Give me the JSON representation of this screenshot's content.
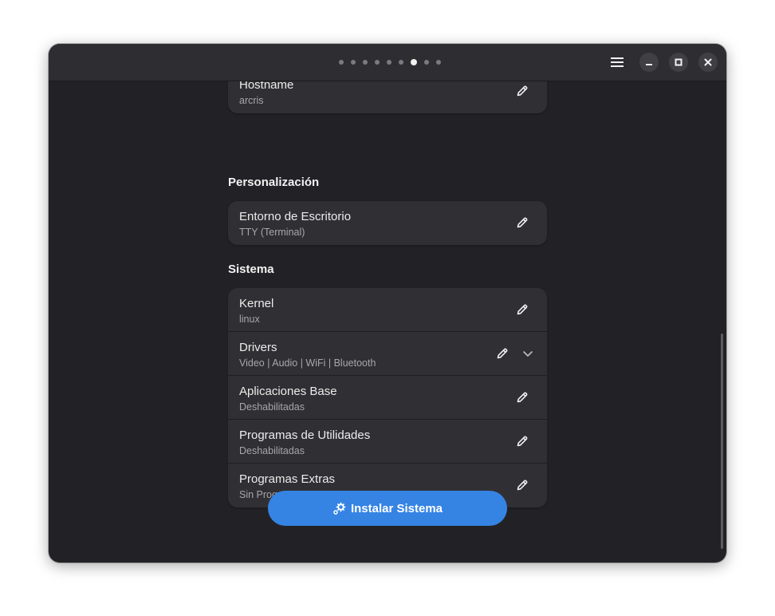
{
  "window": {
    "pages": {
      "total": 9,
      "current": 7
    },
    "menu_icon": "hamburger-menu-icon",
    "minimize_icon": "minimize-icon",
    "maximize_icon": "maximize-icon",
    "close_icon": "close-icon"
  },
  "top_group": {
    "hostname": {
      "title": "Hostname",
      "value": "arcris"
    }
  },
  "personalization": {
    "heading": "Personalización",
    "desktop": {
      "title": "Entorno de Escritorio",
      "value": "TTY (Terminal)"
    }
  },
  "system": {
    "heading": "Sistema",
    "rows": [
      {
        "title": "Kernel",
        "value": "linux"
      },
      {
        "title": "Drivers",
        "value": "Video | Audio | WiFi | Bluetooth"
      },
      {
        "title": "Aplicaciones Base",
        "value": "Deshabilitadas"
      },
      {
        "title": "Programas de Utilidades",
        "value": "Deshabilitadas"
      },
      {
        "title": "Programas Extras",
        "value": "Sin Programas Extras"
      }
    ]
  },
  "install_button": {
    "label": "Instalar Sistema",
    "icon": "gears-icon"
  },
  "colors": {
    "accent": "#3584e4",
    "window_bg": "#222226",
    "card_bg": "#303034"
  }
}
